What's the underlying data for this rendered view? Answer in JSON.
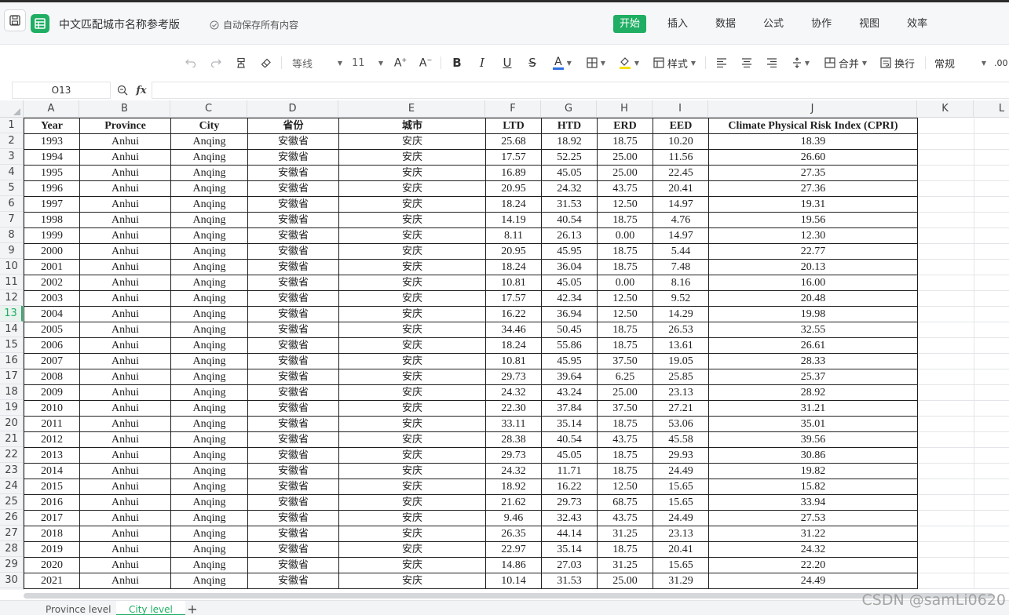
{
  "app": {
    "doc_title": "中文匹配城市名称参考版",
    "autosave": "自动保存所有内容"
  },
  "menu_tabs": [
    {
      "label": "开始",
      "active": true
    },
    {
      "label": "插入"
    },
    {
      "label": "数据"
    },
    {
      "label": "公式"
    },
    {
      "label": "协作"
    },
    {
      "label": "视图"
    },
    {
      "label": "效率"
    }
  ],
  "toolbar": {
    "font_name": "等线",
    "font_size": "11",
    "styles_label": "样式",
    "merge_label": "合并",
    "wrap_label": "换行",
    "number_format": "常规",
    "decimals_label": ".00"
  },
  "colors": {
    "accent": "#1fae63",
    "font_color_bar": "#2f6fe0",
    "fill_color_bar": "#f5e10a"
  },
  "formula_bar": {
    "cell_ref": "O13",
    "formula": ""
  },
  "grid": {
    "column_letters": [
      "A",
      "B",
      "C",
      "D",
      "E",
      "F",
      "G",
      "H",
      "I",
      "J",
      "K",
      "L"
    ],
    "selected_row": 13,
    "header": [
      "Year",
      "Province",
      "City",
      "省份",
      "城市",
      "LTD",
      "HTD",
      "ERD",
      "EED",
      "Climate Physical Risk Index (CPRI)"
    ],
    "rows": [
      [
        "1993",
        "Anhui",
        "Anqing",
        "安徽省",
        "安庆",
        "25.68",
        "18.92",
        "18.75",
        "10.20",
        "18.39"
      ],
      [
        "1994",
        "Anhui",
        "Anqing",
        "安徽省",
        "安庆",
        "17.57",
        "52.25",
        "25.00",
        "11.56",
        "26.60"
      ],
      [
        "1995",
        "Anhui",
        "Anqing",
        "安徽省",
        "安庆",
        "16.89",
        "45.05",
        "25.00",
        "22.45",
        "27.35"
      ],
      [
        "1996",
        "Anhui",
        "Anqing",
        "安徽省",
        "安庆",
        "20.95",
        "24.32",
        "43.75",
        "20.41",
        "27.36"
      ],
      [
        "1997",
        "Anhui",
        "Anqing",
        "安徽省",
        "安庆",
        "18.24",
        "31.53",
        "12.50",
        "14.97",
        "19.31"
      ],
      [
        "1998",
        "Anhui",
        "Anqing",
        "安徽省",
        "安庆",
        "14.19",
        "40.54",
        "18.75",
        "4.76",
        "19.56"
      ],
      [
        "1999",
        "Anhui",
        "Anqing",
        "安徽省",
        "安庆",
        "8.11",
        "26.13",
        "0.00",
        "14.97",
        "12.30"
      ],
      [
        "2000",
        "Anhui",
        "Anqing",
        "安徽省",
        "安庆",
        "20.95",
        "45.95",
        "18.75",
        "5.44",
        "22.77"
      ],
      [
        "2001",
        "Anhui",
        "Anqing",
        "安徽省",
        "安庆",
        "18.24",
        "36.04",
        "18.75",
        "7.48",
        "20.13"
      ],
      [
        "2002",
        "Anhui",
        "Anqing",
        "安徽省",
        "安庆",
        "10.81",
        "45.05",
        "0.00",
        "8.16",
        "16.00"
      ],
      [
        "2003",
        "Anhui",
        "Anqing",
        "安徽省",
        "安庆",
        "17.57",
        "42.34",
        "12.50",
        "9.52",
        "20.48"
      ],
      [
        "2004",
        "Anhui",
        "Anqing",
        "安徽省",
        "安庆",
        "16.22",
        "36.94",
        "12.50",
        "14.29",
        "19.98"
      ],
      [
        "2005",
        "Anhui",
        "Anqing",
        "安徽省",
        "安庆",
        "34.46",
        "50.45",
        "18.75",
        "26.53",
        "32.55"
      ],
      [
        "2006",
        "Anhui",
        "Anqing",
        "安徽省",
        "安庆",
        "18.24",
        "55.86",
        "18.75",
        "13.61",
        "26.61"
      ],
      [
        "2007",
        "Anhui",
        "Anqing",
        "安徽省",
        "安庆",
        "10.81",
        "45.95",
        "37.50",
        "19.05",
        "28.33"
      ],
      [
        "2008",
        "Anhui",
        "Anqing",
        "安徽省",
        "安庆",
        "29.73",
        "39.64",
        "6.25",
        "25.85",
        "25.37"
      ],
      [
        "2009",
        "Anhui",
        "Anqing",
        "安徽省",
        "安庆",
        "24.32",
        "43.24",
        "25.00",
        "23.13",
        "28.92"
      ],
      [
        "2010",
        "Anhui",
        "Anqing",
        "安徽省",
        "安庆",
        "22.30",
        "37.84",
        "37.50",
        "27.21",
        "31.21"
      ],
      [
        "2011",
        "Anhui",
        "Anqing",
        "安徽省",
        "安庆",
        "33.11",
        "35.14",
        "18.75",
        "53.06",
        "35.01"
      ],
      [
        "2012",
        "Anhui",
        "Anqing",
        "安徽省",
        "安庆",
        "28.38",
        "40.54",
        "43.75",
        "45.58",
        "39.56"
      ],
      [
        "2013",
        "Anhui",
        "Anqing",
        "安徽省",
        "安庆",
        "29.73",
        "45.05",
        "18.75",
        "29.93",
        "30.86"
      ],
      [
        "2014",
        "Anhui",
        "Anqing",
        "安徽省",
        "安庆",
        "24.32",
        "11.71",
        "18.75",
        "24.49",
        "19.82"
      ],
      [
        "2015",
        "Anhui",
        "Anqing",
        "安徽省",
        "安庆",
        "18.92",
        "16.22",
        "12.50",
        "15.65",
        "15.82"
      ],
      [
        "2016",
        "Anhui",
        "Anqing",
        "安徽省",
        "安庆",
        "21.62",
        "29.73",
        "68.75",
        "15.65",
        "33.94"
      ],
      [
        "2017",
        "Anhui",
        "Anqing",
        "安徽省",
        "安庆",
        "9.46",
        "32.43",
        "43.75",
        "24.49",
        "27.53"
      ],
      [
        "2018",
        "Anhui",
        "Anqing",
        "安徽省",
        "安庆",
        "26.35",
        "44.14",
        "31.25",
        "23.13",
        "31.22"
      ],
      [
        "2019",
        "Anhui",
        "Anqing",
        "安徽省",
        "安庆",
        "22.97",
        "35.14",
        "18.75",
        "20.41",
        "24.32"
      ],
      [
        "2020",
        "Anhui",
        "Anqing",
        "安徽省",
        "安庆",
        "14.86",
        "27.03",
        "31.25",
        "15.65",
        "22.20"
      ],
      [
        "2021",
        "Anhui",
        "Anqing",
        "安徽省",
        "安庆",
        "10.14",
        "31.53",
        "25.00",
        "31.29",
        "24.49"
      ]
    ]
  },
  "sheet_tabs": [
    {
      "label": "Province level"
    },
    {
      "label": "City level",
      "active": true
    }
  ],
  "watermark": "CSDN @samLi0620"
}
